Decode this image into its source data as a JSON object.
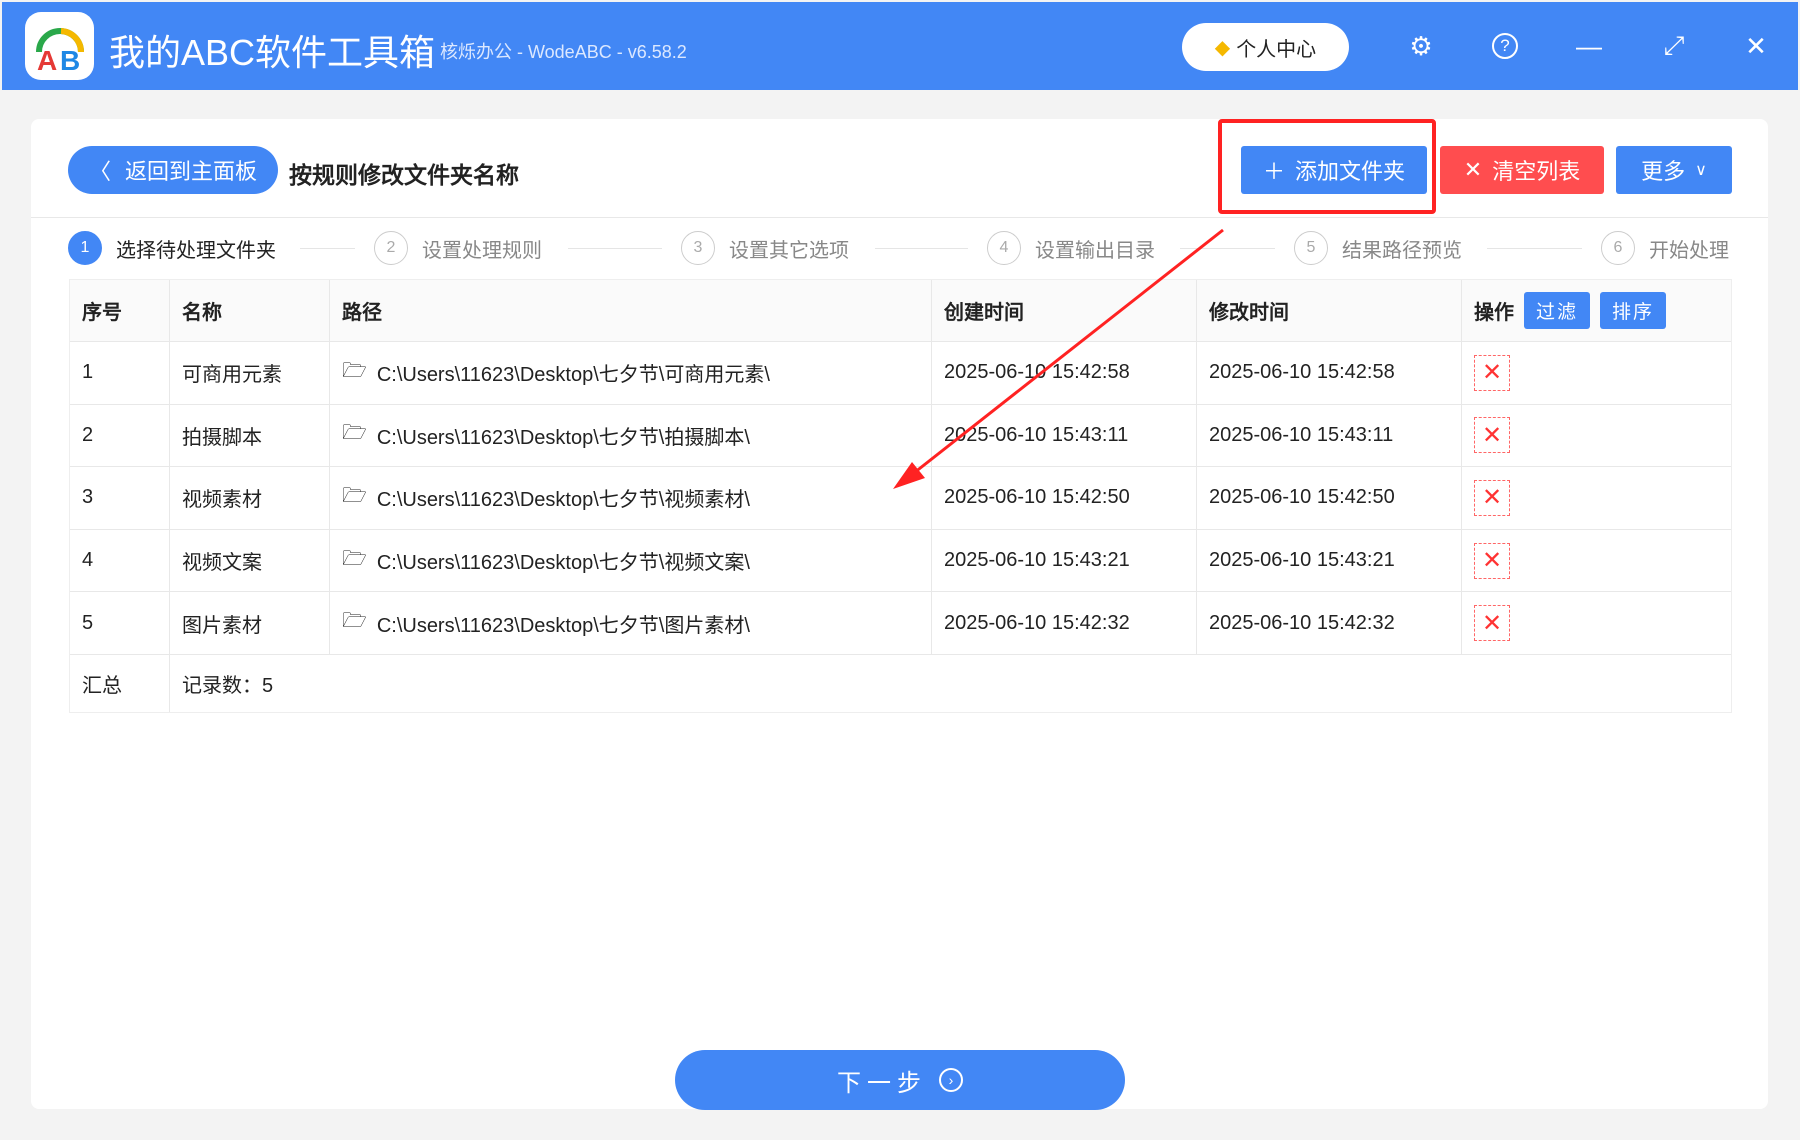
{
  "app": {
    "title": "我的ABC软件工具箱",
    "subtitle": "核烁办公 - WodeABC - v6.58.2",
    "user_center": "个人中心"
  },
  "toolbar": {
    "back": "返回到主面板",
    "page_title": "按规则修改文件夹名称",
    "add": "添加文件夹",
    "clear": "清空列表",
    "more": "更多"
  },
  "steps": [
    {
      "num": "1",
      "label": "选择待处理文件夹"
    },
    {
      "num": "2",
      "label": "设置处理规则"
    },
    {
      "num": "3",
      "label": "设置其它选项"
    },
    {
      "num": "4",
      "label": "设置输出目录"
    },
    {
      "num": "5",
      "label": "结果路径预览"
    },
    {
      "num": "6",
      "label": "开始处理"
    }
  ],
  "table": {
    "headers": {
      "no": "序号",
      "name": "名称",
      "path": "路径",
      "created": "创建时间",
      "modified": "修改时间",
      "action": "操作",
      "filter": "过滤",
      "sort": "排序"
    },
    "rows": [
      {
        "no": "1",
        "name": "可商用元素",
        "path": "C:\\Users\\11623\\Desktop\\七夕节\\可商用元素\\",
        "created": "2025-06-10 15:42:58",
        "modified": "2025-06-10 15:42:58"
      },
      {
        "no": "2",
        "name": "拍摄脚本",
        "path": "C:\\Users\\11623\\Desktop\\七夕节\\拍摄脚本\\",
        "created": "2025-06-10 15:43:11",
        "modified": "2025-06-10 15:43:11"
      },
      {
        "no": "3",
        "name": "视频素材",
        "path": "C:\\Users\\11623\\Desktop\\七夕节\\视频素材\\",
        "created": "2025-06-10 15:42:50",
        "modified": "2025-06-10 15:42:50"
      },
      {
        "no": "4",
        "name": "视频文案",
        "path": "C:\\Users\\11623\\Desktop\\七夕节\\视频文案\\",
        "created": "2025-06-10 15:43:21",
        "modified": "2025-06-10 15:43:21"
      },
      {
        "no": "5",
        "name": "图片素材",
        "path": "C:\\Users\\11623\\Desktop\\七夕节\\图片素材\\",
        "created": "2025-06-10 15:42:32",
        "modified": "2025-06-10 15:42:32"
      }
    ],
    "summary_label": "汇总",
    "summary_value": "记录数：5"
  },
  "next": "下一步",
  "colors": {
    "accent": "#4287f5",
    "danger": "#ff4d4f",
    "highlight": "#ff2222"
  }
}
